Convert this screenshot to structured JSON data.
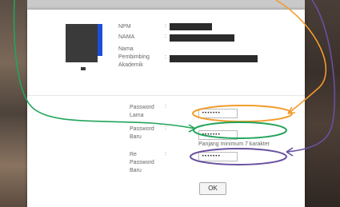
{
  "profile": {
    "npm_label": "NPM",
    "nama_label": "NAMA",
    "pembimbing_label_1": "Nama",
    "pembimbing_label_2": "Pembimbing",
    "pembimbing_label_3": "Akademik",
    "colon": ":"
  },
  "form": {
    "old_password_label_1": "Password",
    "old_password_label_2": "Lama",
    "old_password_value": "•••••••",
    "new_password_label_1": "Password",
    "new_password_label_2": "Baru",
    "new_password_value": "•••••••",
    "hint": "Panjang minimum 7 karakter",
    "repeat_password_label_1": "Re",
    "repeat_password_label_2": "Password",
    "repeat_password_label_3": "Baru",
    "repeat_password_value": "•••••••",
    "ok_label": "OK"
  },
  "colors": {
    "annotation_orange": "#f39b2b",
    "annotation_green": "#22a45a",
    "annotation_purple": "#6a4fa0",
    "avatar_accent": "#1c4fd6"
  }
}
